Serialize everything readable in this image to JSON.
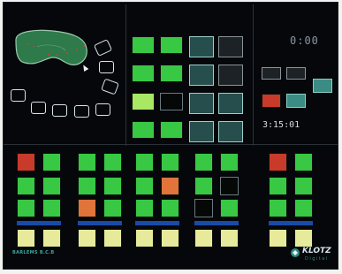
{
  "table_top": {
    "label": ""
  },
  "clock": {
    "top": "0:00",
    "time": "3:15:01"
  },
  "center_block": {
    "col1": [
      {
        "label": "",
        "style": "green"
      },
      {
        "label": "",
        "style": "green"
      },
      {
        "label": "",
        "style": "lime"
      },
      {
        "label": "",
        "style": "green"
      }
    ],
    "col2": [
      {
        "label": "",
        "style": "green"
      },
      {
        "label": "",
        "style": "green"
      },
      {
        "label": "",
        "style": "dark"
      },
      {
        "label": "",
        "style": "green"
      }
    ]
  },
  "right_center_block": [
    {
      "label": "",
      "style": "teal-dark"
    },
    {
      "label": "",
      "style": "grey"
    },
    {
      "label": "",
      "style": "teal-dark"
    },
    {
      "label": "",
      "style": "grey"
    },
    {
      "label": "",
      "style": "teal-dark"
    },
    {
      "label": "",
      "style": "teal-dark"
    },
    {
      "label": "",
      "style": "teal-dark"
    },
    {
      "label": "",
      "style": "teal-dark"
    }
  ],
  "control_block": [
    {
      "label": "",
      "style": "grey"
    },
    {
      "label": "",
      "style": "grey"
    },
    {
      "label": "",
      "style": "teal"
    },
    {
      "label": "",
      "style": "red"
    },
    {
      "label": "",
      "style": "teal"
    }
  ],
  "sections": [
    {
      "label": "",
      "bar": ""
    },
    {
      "label": "",
      "bar": ""
    },
    {
      "label": "",
      "bar": ""
    },
    {
      "label": "",
      "bar": ""
    },
    {
      "label": "",
      "bar": ""
    }
  ],
  "bottom": {
    "left_label": "BARLEMS B.C.B",
    "brand": "KLOTZ",
    "brand_sub": "Digital"
  }
}
